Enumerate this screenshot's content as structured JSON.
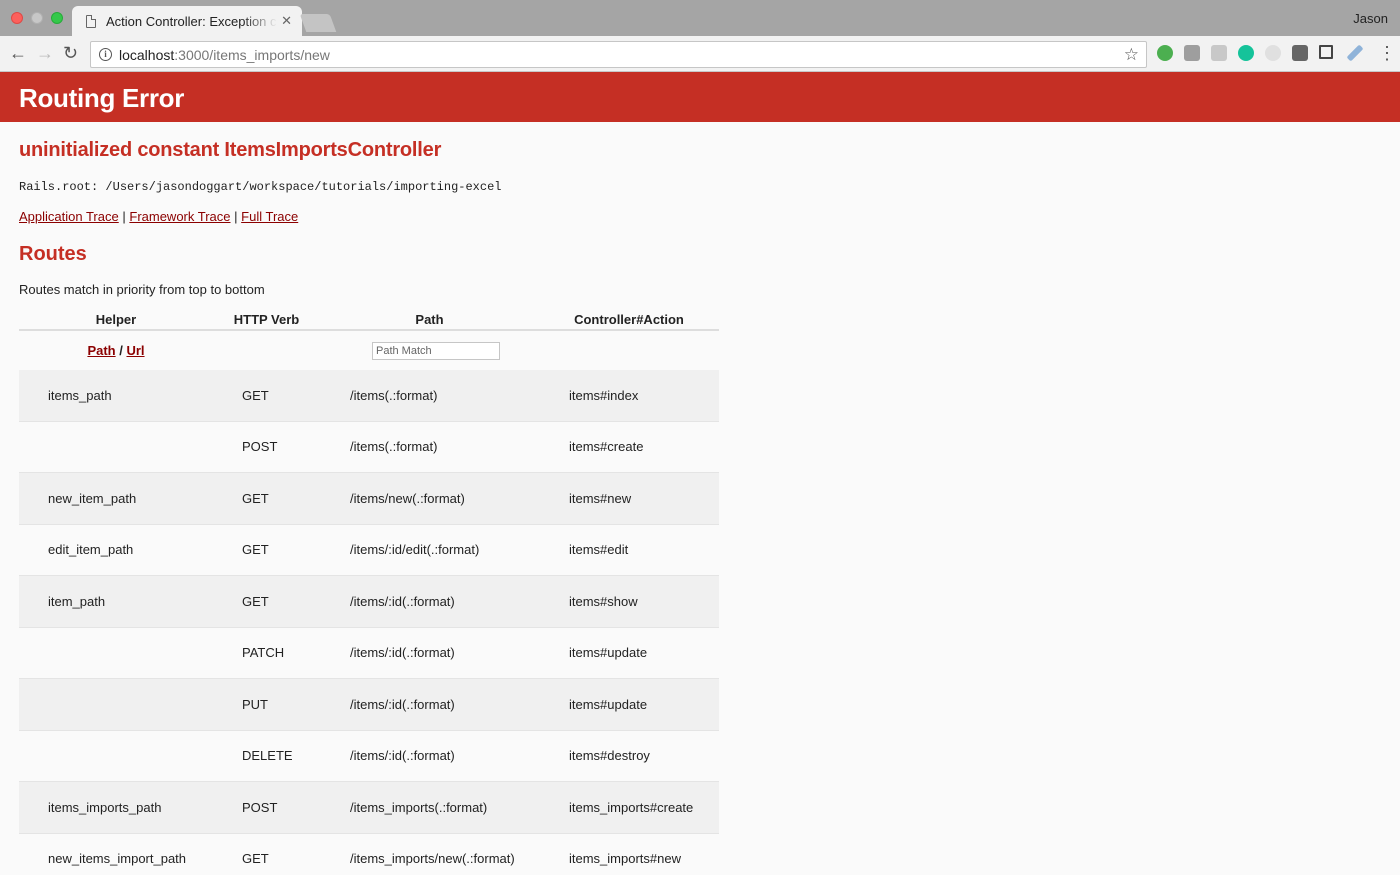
{
  "browser": {
    "tab_title": "Action Controller: Exception caught",
    "url_host": "localhost",
    "url_path": ":3000/items_imports/new",
    "user": "Jason"
  },
  "page": {
    "header": "Routing Error",
    "message": "uninitialized constant ItemsImportsController",
    "rails_root": "Rails.root: /Users/jasondoggart/workspace/tutorials/importing-excel",
    "traces": [
      "Application Trace",
      "Framework Trace",
      "Full Trace"
    ],
    "routes_heading": "Routes",
    "routes_note": "Routes match in priority from top to bottom"
  },
  "routes_table": {
    "columns": [
      "Helper",
      "HTTP Verb",
      "Path",
      "Controller#Action"
    ],
    "helper_links": [
      "Path",
      "Url"
    ],
    "path_match_placeholder": "Path Match",
    "rows": [
      {
        "helper": "items_path",
        "verb": "GET",
        "path": "/items(.:format)",
        "action": "items#index"
      },
      {
        "helper": "",
        "verb": "POST",
        "path": "/items(.:format)",
        "action": "items#create"
      },
      {
        "helper": "new_item_path",
        "verb": "GET",
        "path": "/items/new(.:format)",
        "action": "items#new"
      },
      {
        "helper": "edit_item_path",
        "verb": "GET",
        "path": "/items/:id/edit(.:format)",
        "action": "items#edit"
      },
      {
        "helper": "item_path",
        "verb": "GET",
        "path": "/items/:id(.:format)",
        "action": "items#show"
      },
      {
        "helper": "",
        "verb": "PATCH",
        "path": "/items/:id(.:format)",
        "action": "items#update"
      },
      {
        "helper": "",
        "verb": "PUT",
        "path": "/items/:id(.:format)",
        "action": "items#update"
      },
      {
        "helper": "",
        "verb": "DELETE",
        "path": "/items/:id(.:format)",
        "action": "items#destroy"
      },
      {
        "helper": "items_imports_path",
        "verb": "POST",
        "path": "/items_imports(.:format)",
        "action": "items_imports#create"
      },
      {
        "helper": "new_items_import_path",
        "verb": "GET",
        "path": "/items_imports/new(.:format)",
        "action": "items_imports#new"
      }
    ]
  },
  "colors": {
    "header_bg": "#c52f24",
    "link": "#8b0000",
    "row_shade": "#f0f0f0"
  }
}
